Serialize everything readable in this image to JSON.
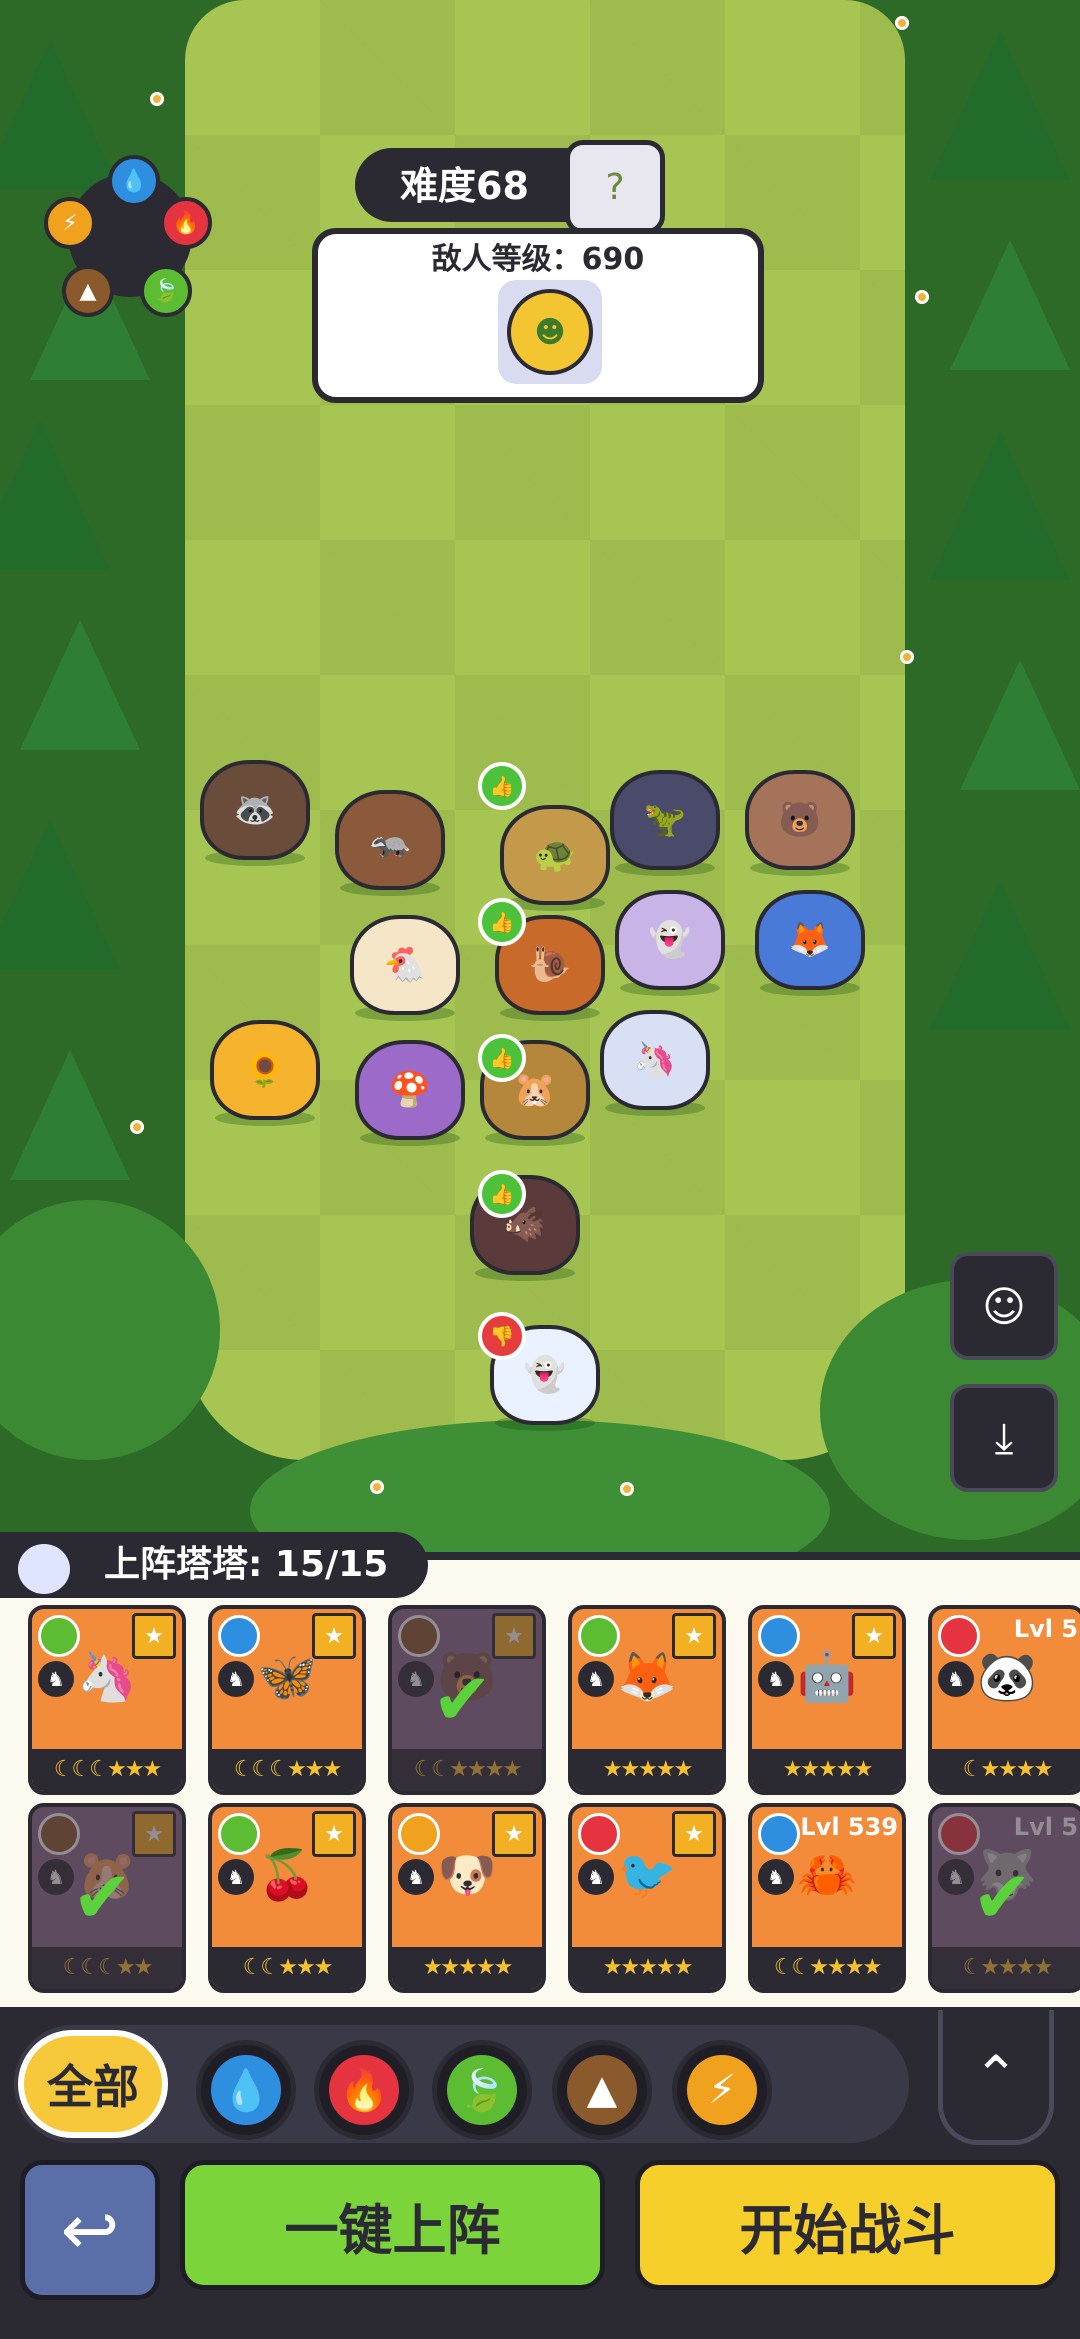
{
  "colors": {
    "water": "#2e8fe0",
    "fire": "#e5343f",
    "leaf": "#5cbc32",
    "earth": "#8a5a2c",
    "bolt": "#f0a21f",
    "panel_dark": "#2b2a33",
    "auto_button": "#7ad43a",
    "start_button": "#f7cf2b"
  },
  "header": {
    "difficulty": "难度68",
    "enemy_level": "敌人等级：690",
    "element_wheel": [
      "water-icon",
      "fire-icon",
      "leaf-icon",
      "earth-icon",
      "bolt-icon"
    ]
  },
  "board": {
    "units": [
      {
        "name": "raccoon-unit",
        "icon": "🦝"
      },
      {
        "name": "ferret-unit",
        "icon": "🦡"
      },
      {
        "name": "turtle-unit",
        "icon": "🐢"
      },
      {
        "name": "dragon-unit",
        "icon": "🦖"
      },
      {
        "name": "bear-unit",
        "icon": "🐻"
      },
      {
        "name": "chicken-unit",
        "icon": "🐔"
      },
      {
        "name": "snail-unit",
        "icon": "🐌"
      },
      {
        "name": "spirit-unit",
        "icon": "👻"
      },
      {
        "name": "fox-unit",
        "icon": "🦊"
      },
      {
        "name": "flower-unit",
        "icon": "🌻"
      },
      {
        "name": "mushroom-unit",
        "icon": "🍄"
      },
      {
        "name": "mole-unit",
        "icon": "🐹"
      },
      {
        "name": "fairy-unit",
        "icon": "🦄"
      },
      {
        "name": "boar-unit",
        "icon": "🐗"
      },
      {
        "name": "ghost-unit",
        "icon": "👻"
      }
    ]
  },
  "team": {
    "label": "上阵塔塔: 15/15"
  },
  "cards": [
    {
      "element": "leaf",
      "lvl": "",
      "stars": "☾☾☾★★★",
      "art": "🦄",
      "bg": "#f28c3a",
      "deployed": false,
      "fav": true
    },
    {
      "element": "water",
      "lvl": "",
      "stars": "☾☾☾★★★",
      "art": "🦋",
      "bg": "#f28c3a",
      "deployed": false,
      "fav": true
    },
    {
      "element": "earth",
      "lvl": "",
      "stars": "☾☾★★★★",
      "art": "🐻",
      "bg": "#8a6a8a",
      "deployed": true,
      "fav": true
    },
    {
      "element": "leaf",
      "lvl": "",
      "stars": "★★★★★",
      "art": "🦊",
      "bg": "#f28c3a",
      "deployed": false,
      "fav": true
    },
    {
      "element": "water",
      "lvl": "",
      "stars": "★★★★★",
      "art": "🤖",
      "bg": "#f28c3a",
      "deployed": false,
      "fav": true
    },
    {
      "element": "fire",
      "lvl": "Lvl 5",
      "stars": "☾★★★★",
      "art": "🐼",
      "bg": "#f28c3a",
      "deployed": false,
      "fav": false
    },
    {
      "element": "earth",
      "lvl": "",
      "stars": "☾☾☾★★",
      "art": "🐹",
      "bg": "#8a6a8a",
      "deployed": true,
      "fav": true
    },
    {
      "element": "leaf",
      "lvl": "",
      "stars": "☾☾★★★",
      "art": "🍒",
      "bg": "#f28c3a",
      "deployed": false,
      "fav": true
    },
    {
      "element": "bolt",
      "lvl": "",
      "stars": "★★★★★",
      "art": "🐶",
      "bg": "#f28c3a",
      "deployed": false,
      "fav": true
    },
    {
      "element": "fire",
      "lvl": "",
      "stars": "★★★★★",
      "art": "🐦",
      "bg": "#f28c3a",
      "deployed": false,
      "fav": true
    },
    {
      "element": "water",
      "lvl": "Lvl 539",
      "stars": "☾☾★★★★",
      "art": "🦀",
      "bg": "#f28c3a",
      "deployed": false,
      "fav": false
    },
    {
      "element": "fire",
      "lvl": "Lvl 5",
      "stars": "☾★★★★",
      "art": "🐺",
      "bg": "#8a6a8a",
      "deployed": true,
      "fav": false
    }
  ],
  "filters": {
    "all_label": "全部",
    "elements": [
      "water-icon",
      "fire-icon",
      "leaf-icon",
      "earth-icon",
      "bolt-icon"
    ]
  },
  "actions": {
    "auto_deploy": "一键上阵",
    "start_battle": "开始战斗"
  }
}
